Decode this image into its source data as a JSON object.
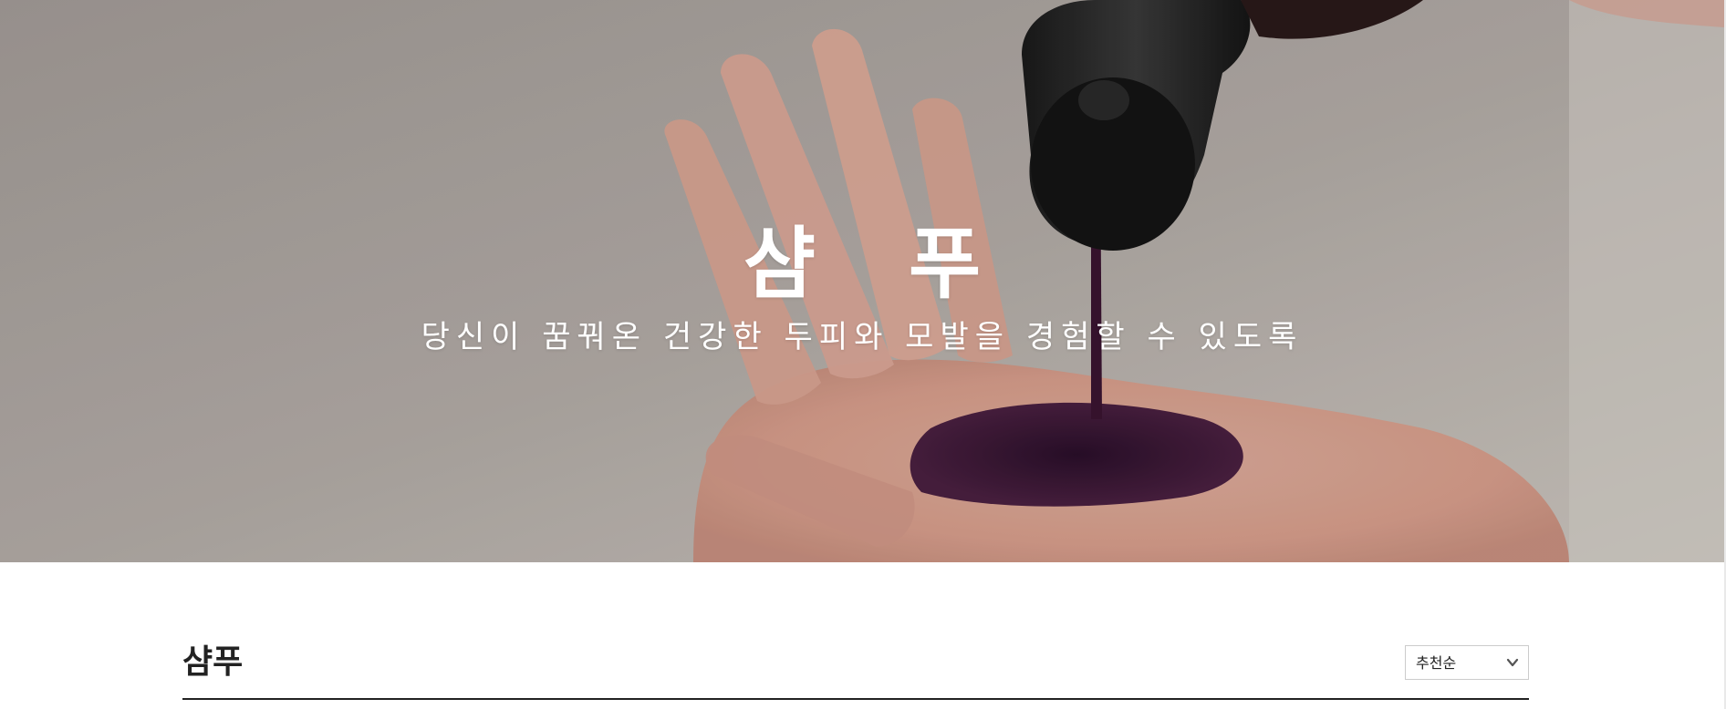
{
  "hero": {
    "title": "샴 푸",
    "subtitle": "당신이 꿈꿔온 건강한 두피와 모발을 경험할 수 있도록"
  },
  "section": {
    "title": "샴푸",
    "sort": {
      "selected": "추천순"
    }
  },
  "icons": {
    "sort_chevron": "chevron-down-icon"
  },
  "colors": {
    "hero_bg": "#aaa39f",
    "text_dark": "#222222",
    "rule": "#222222"
  }
}
